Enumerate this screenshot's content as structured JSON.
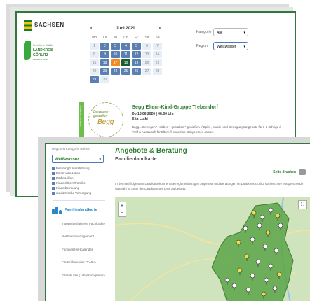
{
  "back": {
    "sachsen_logo_text": "SACHSEN",
    "landkreis_logo": {
      "line1": "Kreisfreie Städte",
      "line2": "LANDKREIS",
      "line3": "GÖRLITZ",
      "line4": "Landkreis Görlitz"
    },
    "calendar": {
      "prev": "«",
      "month": "Juni 2020",
      "next": "»",
      "weekdays": [
        "Mo",
        "Di",
        "Mi",
        "Do",
        "Fr",
        "Sa",
        "So"
      ],
      "days": [
        "1",
        "2",
        "3",
        "4",
        "5",
        "6",
        "7",
        "8",
        "9",
        "10",
        "11",
        "12",
        "13",
        "14",
        "15",
        "16",
        "17",
        "18",
        "19",
        "20",
        "21",
        "22",
        "23",
        "24",
        "25",
        "26",
        "27",
        "28",
        "29",
        "30"
      ]
    },
    "filters": {
      "kategorie_label": "Kategorie",
      "kategorie_value": "Alle",
      "region_label": "Region",
      "region_value": "Weißwasser"
    },
    "event": {
      "badge_text": "FAMILIENANGEBOTE",
      "logo_ring": "Bewegen · gestalten",
      "logo_name": "Begg",
      "title": "Begg Eltern-Kind-Gruppe Trebendorf",
      "date": "Do 18.06.2020 | 08:00 Uhr",
      "place": "Kita Lutki",
      "description": "Begg = Bewegen * erleben * gestalten * genießen // Spiel-, Musik- und Bewegungsangebote für 0-3-Jährige // Treff & Austausch für Eltern // ohne Ihre Babys eines Jahres"
    }
  },
  "front": {
    "sidebar": {
      "hint": "Region & Kategorie wählen",
      "region_value": "Weißwasser",
      "categories": [
        "Beratung/Unterstützung",
        "Finanzielle Hilfen",
        "Frühe Hilfen",
        "Kinder/Eltern/Familie",
        "Kinderbetreuung",
        "medizinische Versorgung"
      ],
      "active_nav": "Familienlandkarte",
      "nav_items": [
        "Insoweit erfahrene Fachkräfte",
        "Netzwerkmanagement",
        "Familienzeit-Kalender",
        "Freizeitkalender PAULA",
        "Elternkurse (Jahresprogramm)"
      ]
    },
    "content": {
      "title": "Angebote & Beratung",
      "subtitle": "Familienlandkarte",
      "print_label": "Seite drucken",
      "intro": "In der nachfolgenden Landkarte können Sie regionenbezogen Angebote und Beratungen im Landkreis Görlitz suchen. Ihre entsprechende Auswahl ist unter der Landkarte als Liste aufgeführt."
    },
    "map": {
      "zoom_in": "+",
      "zoom_out": "−",
      "fullscreen": "⛶",
      "marker_count": 24
    }
  },
  "colors": {
    "green_frame": "#2f7a3b",
    "heading_green": "#2d7d33",
    "nav_blue": "#2a88c9",
    "event_orange": "#f08a24",
    "calendar_blue": "#5b7fb1",
    "region_fill": "#5aa548"
  }
}
